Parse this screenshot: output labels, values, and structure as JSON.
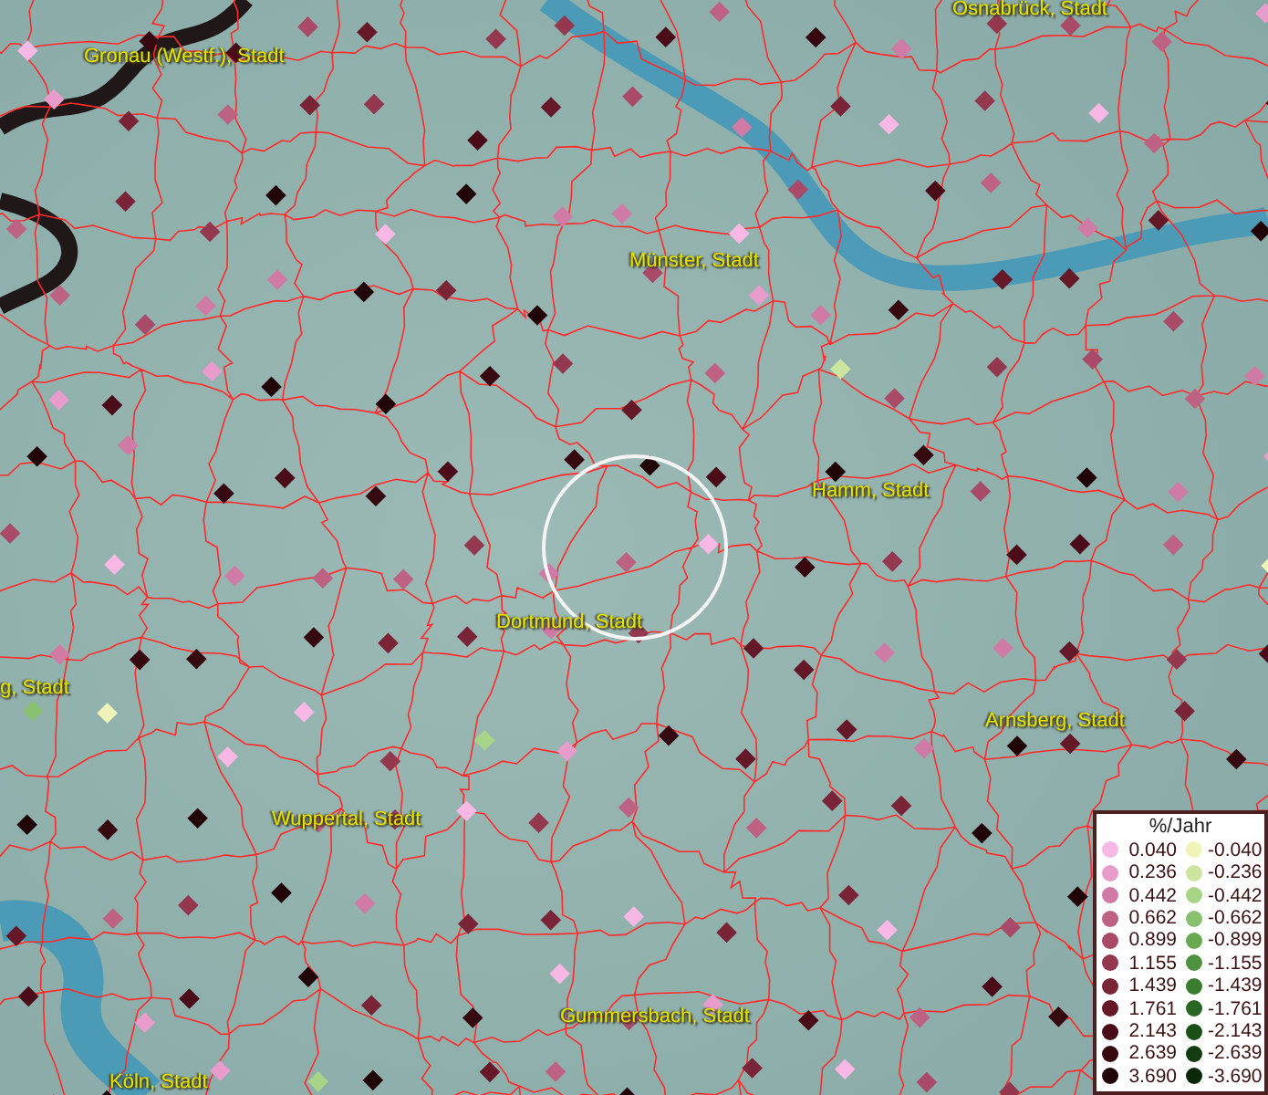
{
  "map": {
    "places": [
      {
        "name": "Osnabrück, Stadt"
      },
      {
        "name": "Gronau (Westf.), Stadt"
      },
      {
        "name": "Münster, Stadt"
      },
      {
        "name": "Hamm, Stadt"
      },
      {
        "name": "Dortmund, Stadt"
      },
      {
        "name": "g, Stadt"
      },
      {
        "name": "Arnsberg, Stadt"
      },
      {
        "name": "Wuppertal, Stadt"
      },
      {
        "name": "Gummersbach, Stadt"
      },
      {
        "name": "Köln, Stadt"
      }
    ]
  },
  "legend": {
    "title": "%/Jahr",
    "rows": [
      {
        "positive": {
          "value": "0.040",
          "color": "#f7b8e6"
        },
        "negative": {
          "value": "-0.040",
          "color": "#f0f4b8"
        }
      },
      {
        "positive": {
          "value": "0.236",
          "color": "#e79ccc"
        },
        "negative": {
          "value": "-0.236",
          "color": "#cce6a0"
        }
      },
      {
        "positive": {
          "value": "0.442",
          "color": "#d07aa6"
        },
        "negative": {
          "value": "-0.442",
          "color": "#a8d488"
        }
      },
      {
        "positive": {
          "value": "0.662",
          "color": "#be6283"
        },
        "negative": {
          "value": "-0.662",
          "color": "#88c070"
        }
      },
      {
        "positive": {
          "value": "0.899",
          "color": "#a84a68"
        },
        "negative": {
          "value": "-0.899",
          "color": "#68a850"
        }
      },
      {
        "positive": {
          "value": "1.155",
          "color": "#93384f"
        },
        "negative": {
          "value": "-1.155",
          "color": "#4e9240"
        }
      },
      {
        "positive": {
          "value": "1.439",
          "color": "#7a2438"
        },
        "negative": {
          "value": "-1.439",
          "color": "#3a7c30"
        }
      },
      {
        "positive": {
          "value": "1.761",
          "color": "#641828"
        },
        "negative": {
          "value": "-1.761",
          "color": "#2a6624"
        }
      },
      {
        "positive": {
          "value": "2.143",
          "color": "#4a0c18"
        },
        "negative": {
          "value": "-2.143",
          "color": "#1a5018"
        }
      },
      {
        "positive": {
          "value": "2.639",
          "color": "#360810"
        },
        "negative": {
          "value": "-2.639",
          "color": "#103c10"
        }
      },
      {
        "positive": {
          "value": "3.690",
          "color": "#200408"
        },
        "negative": {
          "value": "-3.690",
          "color": "#082808"
        }
      }
    ]
  }
}
